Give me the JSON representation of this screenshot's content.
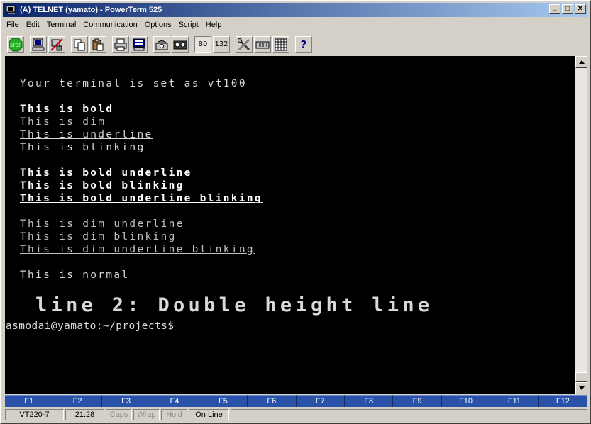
{
  "window": {
    "title": "(A) TELNET (yamato) - PowerTerm 525",
    "minimize_glyph": "_",
    "maximize_glyph": "□",
    "close_glyph": "✕"
  },
  "menu": [
    "File",
    "Edit",
    "Terminal",
    "Communication",
    "Options",
    "Script",
    "Help"
  ],
  "toolbar": {
    "stop_label": "STOP",
    "cols80_label": "80",
    "cols132_label": "132",
    "help_label": "?"
  },
  "terminal": {
    "lines": [
      {
        "text": "Your terminal is set as vt100",
        "style": "normal"
      },
      {
        "text": "This is bold",
        "style": "bold"
      },
      {
        "text": "This is dim",
        "style": "dim"
      },
      {
        "text": "This is underline",
        "style": "underline"
      },
      {
        "text": "This is blinking",
        "style": "blink"
      },
      {
        "text": "This is bold underline",
        "style": "bold-underline"
      },
      {
        "text": "This is bold blinking",
        "style": "bold-blink"
      },
      {
        "text": "This is bold underline blinking",
        "style": "bold-underline-blink"
      },
      {
        "text": "This is dim underline",
        "style": "dim-underline"
      },
      {
        "text": "This is dim blinking",
        "style": "dim-blink"
      },
      {
        "text": "This is dim underline blinking",
        "style": "dim-underline-blink"
      },
      {
        "text": "This is normal",
        "style": "normal"
      },
      {
        "text": "line 2: Double height line",
        "style": "double"
      },
      {
        "text": "asmodai@yamato:~/projects$",
        "style": "prompt"
      }
    ]
  },
  "function_keys": [
    "F1",
    "F2",
    "F3",
    "F4",
    "F5",
    "F6",
    "F7",
    "F8",
    "F9",
    "F10",
    "F11",
    "F12"
  ],
  "status": {
    "emulation": "VT220-7",
    "cursor_pos": "21:28",
    "caps": "Caps",
    "wrap": "Wrap",
    "hold": "Hold",
    "online": "On Line"
  }
}
